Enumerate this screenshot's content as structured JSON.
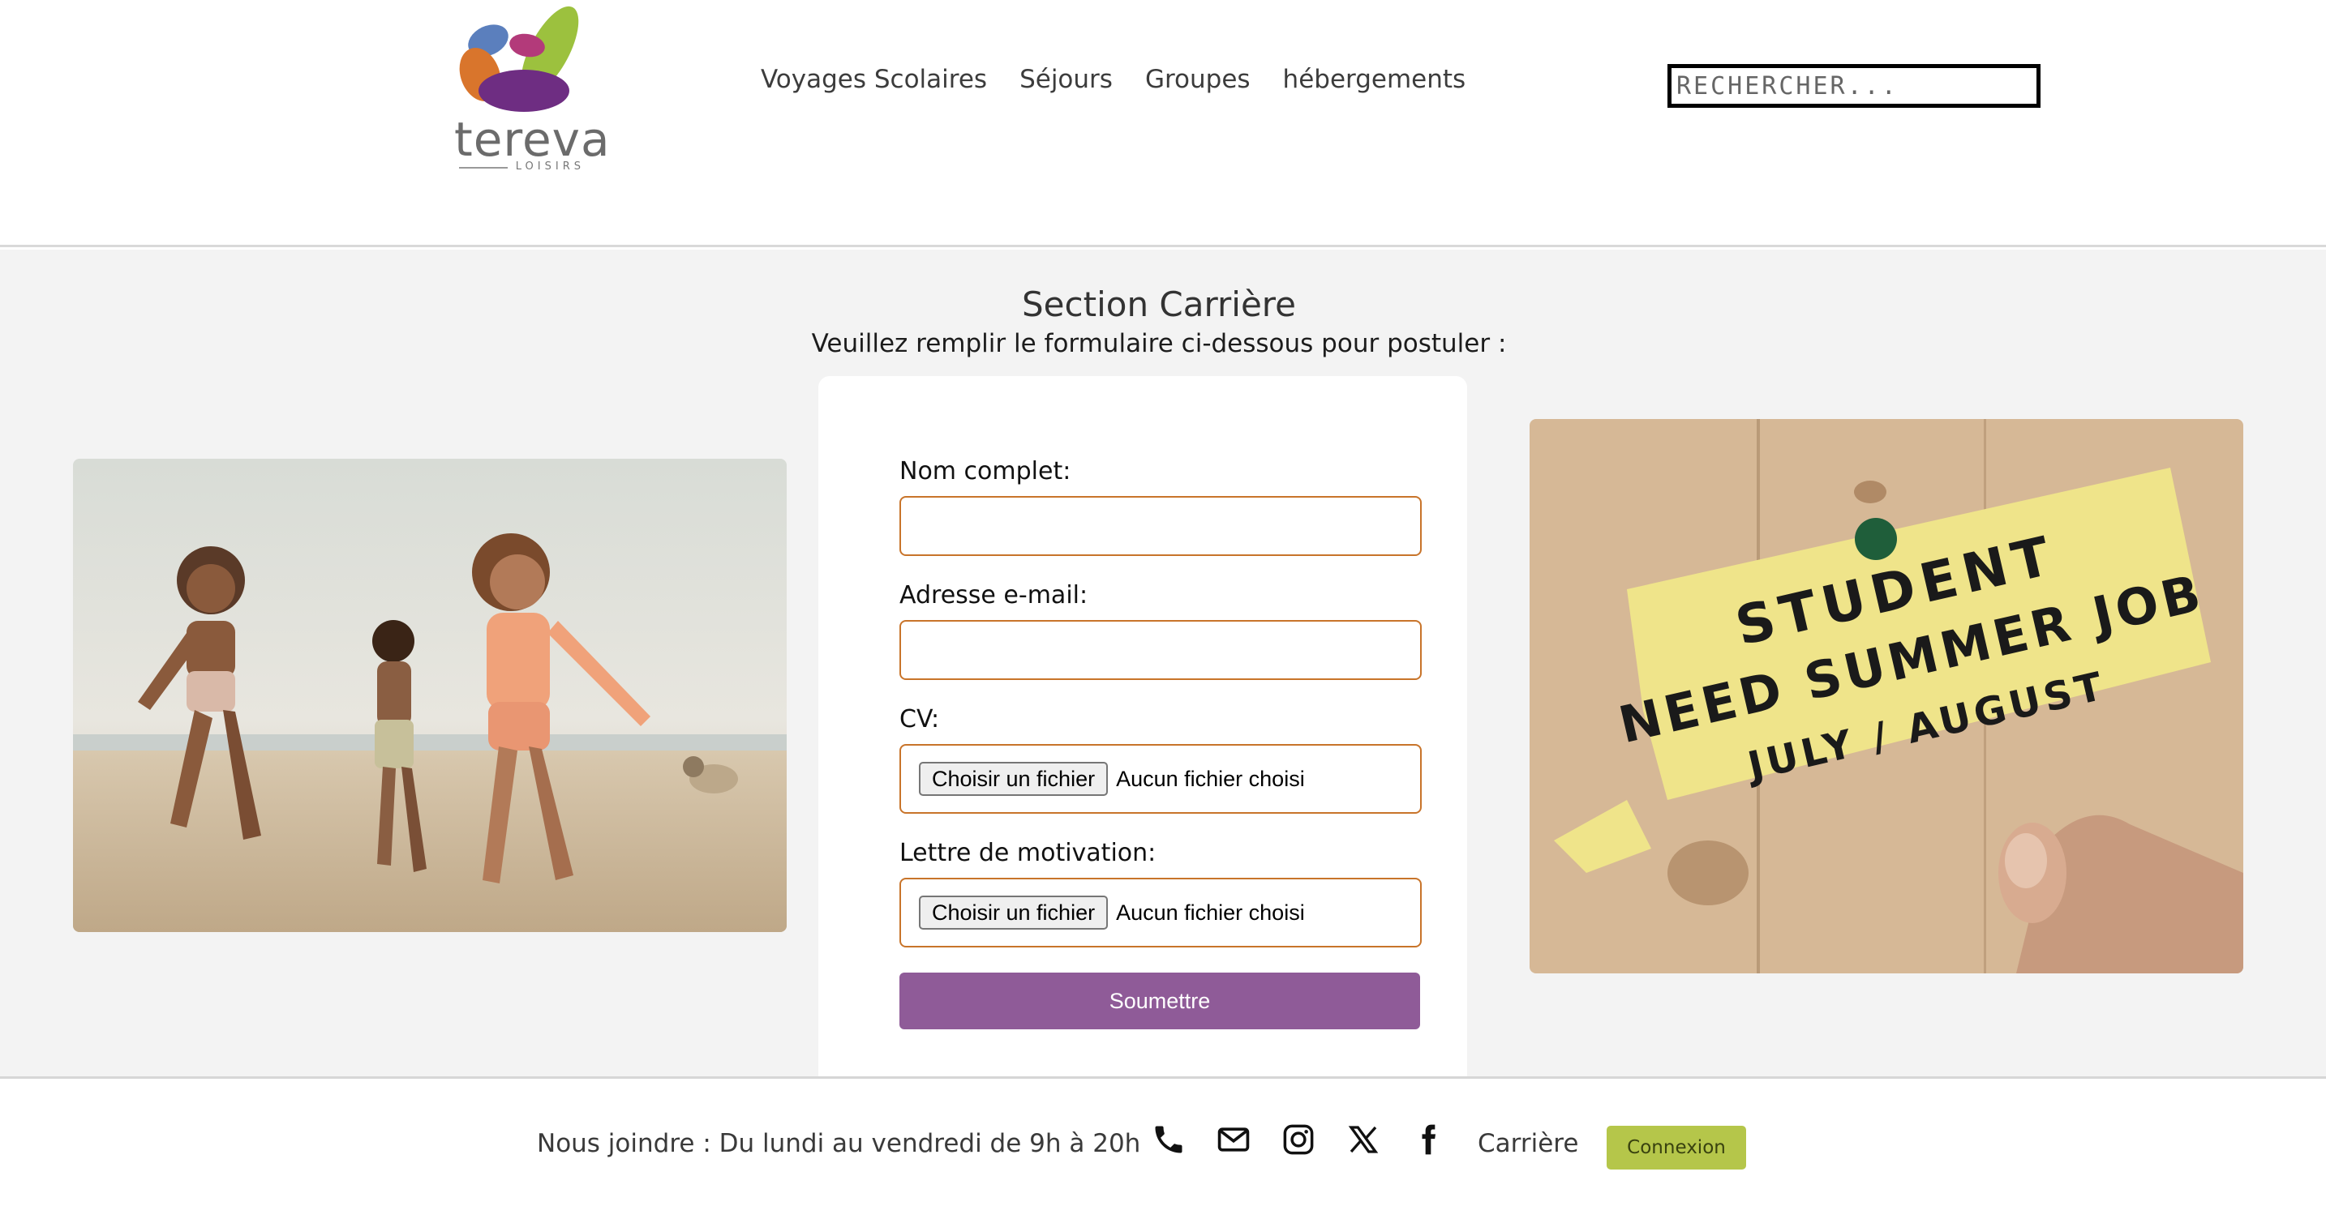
{
  "header": {
    "logo": {
      "name": "tereva",
      "tagline": "LOISIRS"
    },
    "nav": [
      {
        "label": "Voyages Scolaires"
      },
      {
        "label": "Séjours"
      },
      {
        "label": "Groupes"
      },
      {
        "label": "hébergements"
      }
    ],
    "search": {
      "placeholder": "RECHERCHER...",
      "value": ""
    }
  },
  "main": {
    "title": "Section Carrière",
    "subtitle": "Veuillez remplir le formulaire ci-dessous pour postuler :",
    "form": {
      "name_label": "Nom complet:",
      "name_value": "",
      "email_label": "Adresse e-mail:",
      "email_value": "",
      "cv_label": "CV:",
      "cv_button": "Choisir un fichier",
      "cv_status": "Aucun fichier choisi",
      "letter_label": "Lettre de motivation:",
      "letter_button": "Choisir un fichier",
      "letter_status": "Aucun fichier choisi",
      "submit_label": "Soumettre"
    },
    "images": {
      "right_note": [
        "STUDENT",
        "NEED SUMMER JOB",
        "JULY / AUGUST"
      ]
    }
  },
  "footer": {
    "contact_text": "Nous joindre : Du lundi au vendredi de 9h à 20h",
    "icons": [
      "phone-icon",
      "mail-icon",
      "instagram-icon",
      "x-icon",
      "facebook-icon"
    ],
    "career_link": "Carrière",
    "login_button": "Connexion"
  },
  "colors": {
    "accent_orange": "#c8742a",
    "submit_purple": "#8f5b98",
    "login_green": "#b5c64a",
    "main_bg": "#f3f3f3"
  }
}
